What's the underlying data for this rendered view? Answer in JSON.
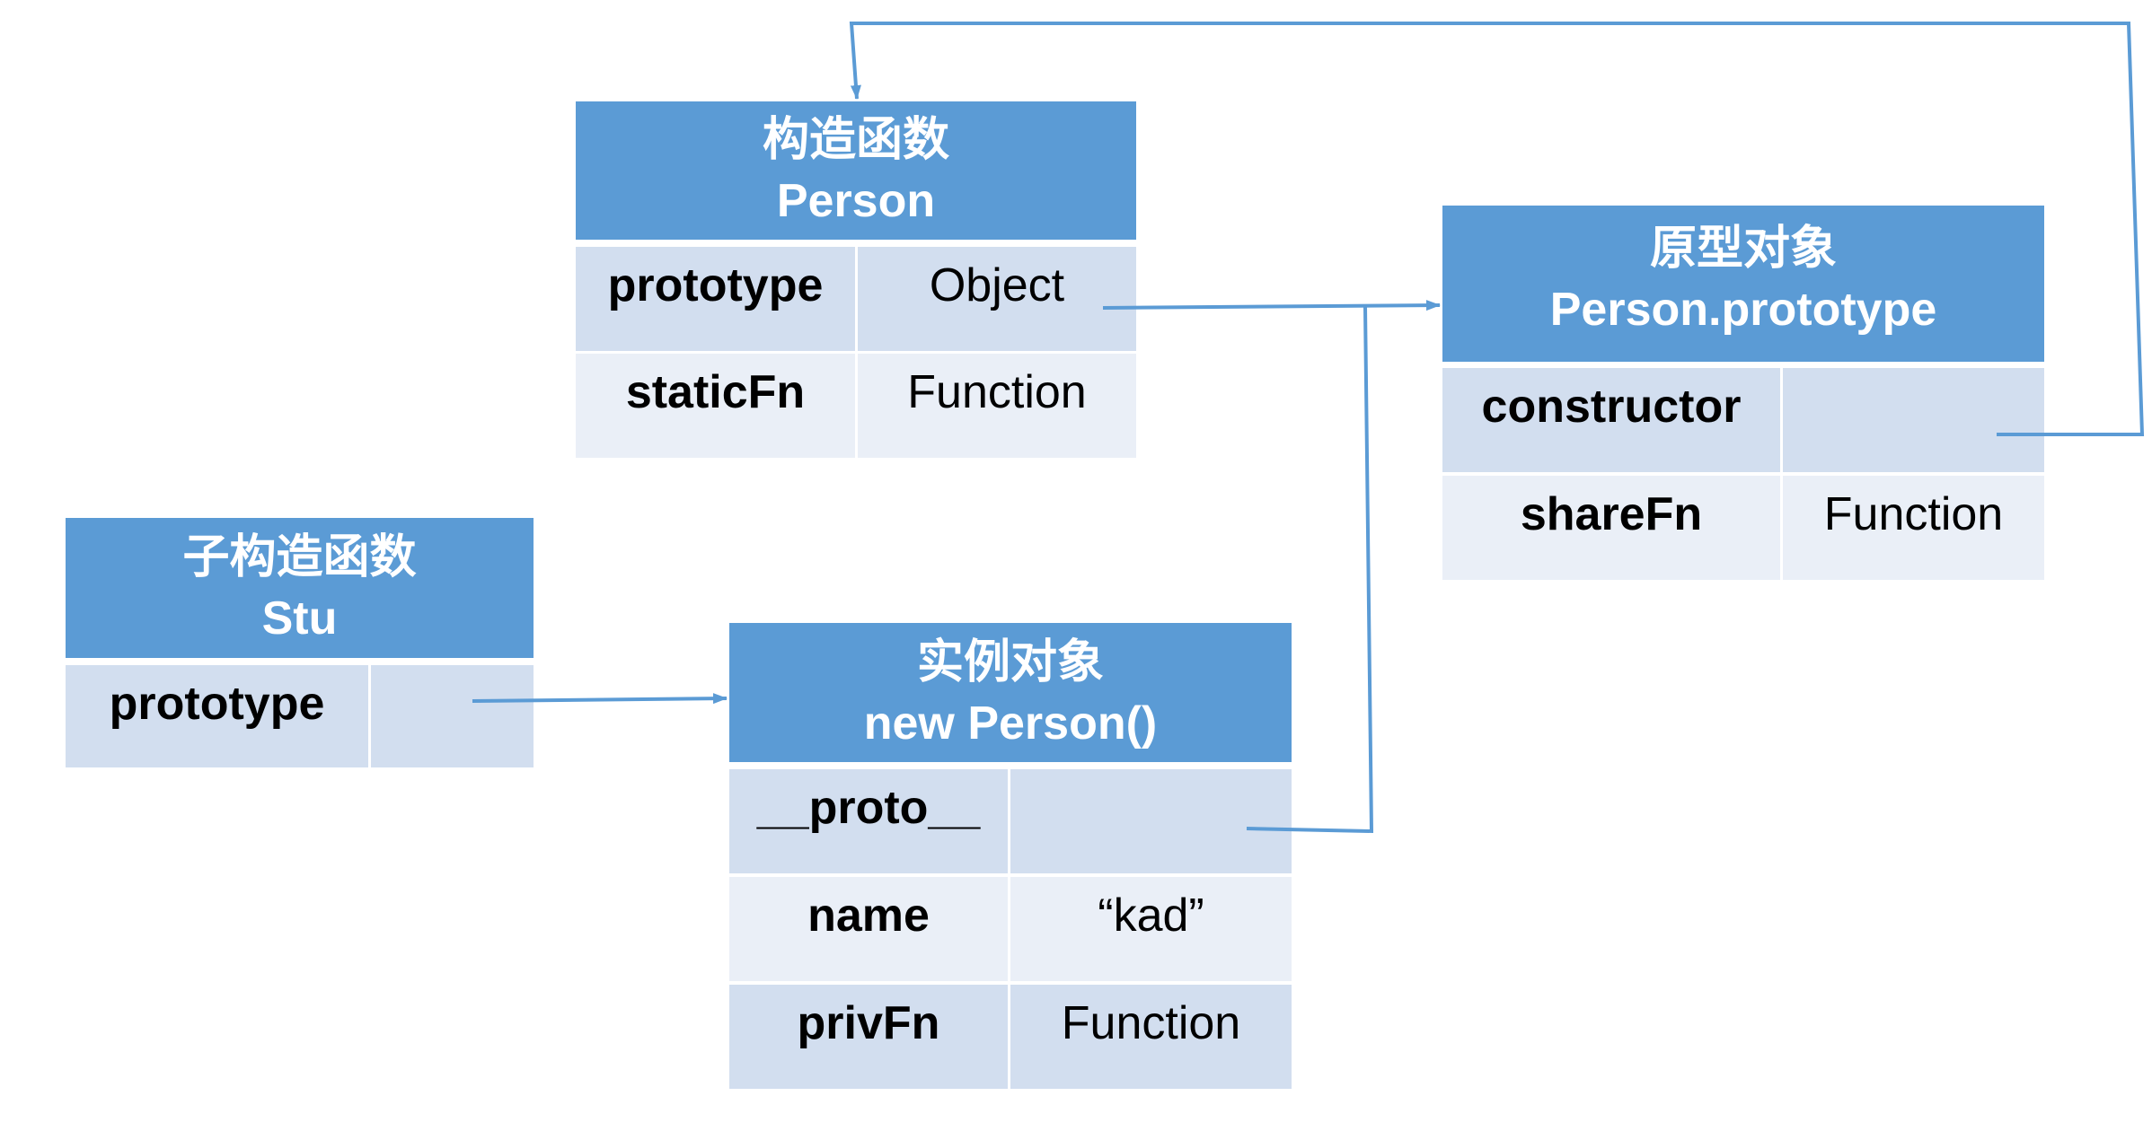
{
  "colors": {
    "header": "#5B9BD5",
    "row_dark": "#D2DEEF",
    "row_light": "#EAEFF7",
    "arrow": "#5B9BD5",
    "header_text": "#FFFFFF",
    "cell_text": "#000000"
  },
  "constructor_table": {
    "title": [
      "构造函数",
      "Person"
    ],
    "rows": [
      {
        "key": "prototype",
        "value": "Object"
      },
      {
        "key": "staticFn",
        "value": "Function"
      }
    ]
  },
  "prototype_table": {
    "title": [
      "原型对象",
      "Person.prototype"
    ],
    "rows": [
      {
        "key": "constructor"
      },
      {
        "key": "shareFn",
        "value": "Function"
      }
    ]
  },
  "sub_constructor_table": {
    "title": [
      "子构造函数",
      "Stu"
    ],
    "rows": [
      {
        "key": "prototype"
      }
    ]
  },
  "instance_table": {
    "title": [
      "实例对象",
      "new Person()"
    ],
    "rows": [
      {
        "key": "__proto__"
      },
      {
        "key": "name",
        "value": "“kad”"
      },
      {
        "key": "privFn",
        "value": "Function"
      }
    ]
  }
}
